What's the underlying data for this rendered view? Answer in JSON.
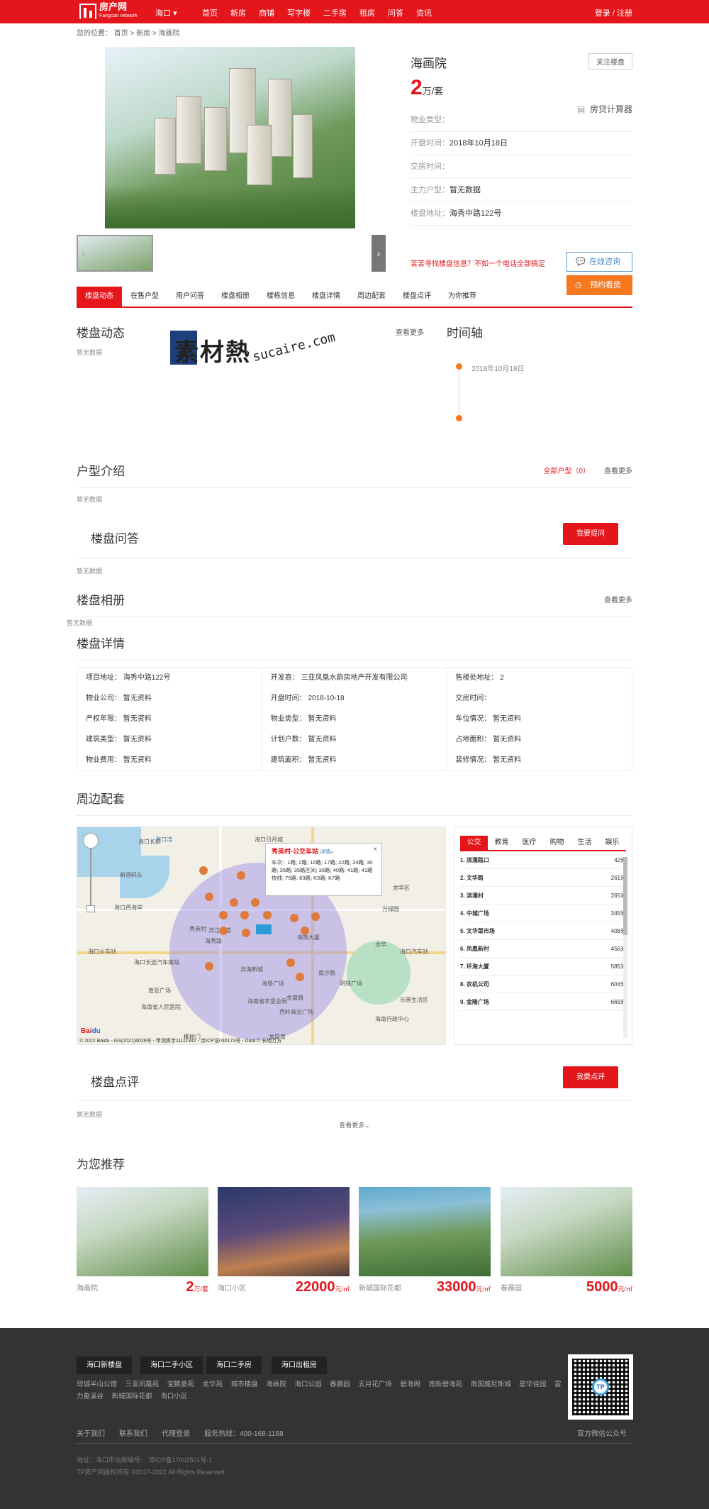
{
  "header": {
    "logo_cn": "房产网",
    "logo_en": "Fangcan network",
    "city": "海口",
    "nav": [
      "首页",
      "新房",
      "商铺",
      "写字楼",
      "二手房",
      "租房",
      "问答",
      "资讯"
    ],
    "login": "登录 / 注册"
  },
  "breadcrumb": "您的位置： 首页 > 新房 > 海画院",
  "property": {
    "name": "海画院",
    "follow": "关注楼盘",
    "price_num": "2",
    "price_unit": "万/套",
    "calc": "房贷计算器",
    "rows": [
      {
        "label": "物业类型：",
        "value": ""
      },
      {
        "label": "开盘时间：",
        "value": "2018年10月18日"
      },
      {
        "label": "交房时间：",
        "value": ""
      },
      {
        "label": "主力户型：",
        "value": "暂无数据"
      },
      {
        "label": "楼盘地址：",
        "value": "海秀中路122号"
      }
    ],
    "hotline": "苦苦寻找楼盘信息？不如一个电话全部搞定",
    "consult": "在线咨询",
    "visit": "预约看房"
  },
  "tabs": [
    "楼盘动态",
    "在售户型",
    "用户问答",
    "楼盘相册",
    "楼栋信息",
    "楼盘详情",
    "周边配套",
    "楼盘点评",
    "为你推荐"
  ],
  "dynamics": {
    "title": "楼盘动态",
    "more": "查看更多",
    "empty": "暂无数据"
  },
  "watermark": {
    "cn": "素材熱",
    "en": "sucaire.com"
  },
  "timeline": {
    "title": "时间轴",
    "date": "2018年10月18日"
  },
  "units": {
    "title": "户型介绍",
    "all": "全部户型（0）",
    "more": "查看更多",
    "empty": "暂无数据"
  },
  "qa": {
    "title": "楼盘问答",
    "button": "我要提问",
    "empty": "暂无数据"
  },
  "album": {
    "title": "楼盘相册",
    "more": "查看更多",
    "empty": "暂无数据"
  },
  "detail": {
    "title": "楼盘详情",
    "rows": [
      [
        "项目地址：  海秀中路122号",
        "开发商：  三亚凤凰水韵房地产开发有限公司",
        "售楼处地址：  2"
      ],
      [
        "物业公司：  暂无资料",
        "开盘时间：  2018-10-18",
        "交房时间："
      ],
      [
        "产权年限：  暂无资料",
        "物业类型：  暂无资料",
        "车位情况：  暂无资料"
      ],
      [
        "建筑类型：  暂无资料",
        "计划户数：  暂无资料",
        "占地面积：  暂无资料"
      ],
      [
        "物业费用：  暂无资料",
        "建筑面积：  暂无资料",
        "装修情况：  暂无资料"
      ]
    ]
  },
  "surround": {
    "title": "周边配套",
    "popup_title": "秀英村-公交车站",
    "popup_link": "详情»",
    "popup_body": "车次：1路; 2路; 16路; 17路; 22路; 24路; 30路; 35路; 35路区间; 36路; 40路; 41路; 41路快线; 75路; 83路; K5路; K7路",
    "map_labels": [
      "海口长影",
      "海口西海岸",
      "秀英村",
      "海秀路",
      "滨江大道",
      "海口火车站",
      "海口长途汽车南站",
      "海南省人民医院",
      "万绿园",
      "南沙路",
      "龙华",
      "海南大厦",
      "海垦广场",
      "海南省农垦总局",
      "西岭商业广场",
      "明珠广场",
      "滨海新城",
      "海口汽车站",
      "海南行政中心",
      "乐普生活区",
      "椰树门",
      "海口日月城",
      "南亚广场",
      "龙昆南",
      "龙华区",
      "金盘路",
      "海口湾",
      "新港码头"
    ],
    "map_footer": "© 2022 Baidu - GS(2021)6026号 - 甲测资字11111342 - 京ICP证030173号 - Data © 长地万方",
    "poi_tabs": [
      "公交",
      "教育",
      "医疗",
      "购物",
      "生活",
      "娱乐"
    ],
    "poi": [
      [
        "1. 滨濡路口",
        "42米"
      ],
      [
        "2. 文华路",
        "261米"
      ],
      [
        "3. 滨濡村",
        "265米"
      ],
      [
        "4. 中城广场",
        "345米"
      ],
      [
        "5. 文华菜市场",
        "408米"
      ],
      [
        "6. 凤凰新村",
        "456米"
      ],
      [
        "7. 环海大厦",
        "585米"
      ],
      [
        "8. 农机公司",
        "604米"
      ],
      [
        "9. 金隆广场",
        "669米"
      ]
    ]
  },
  "review": {
    "title": "楼盘点评",
    "button": "我要点评",
    "empty": "暂无数据",
    "more": "查看更多"
  },
  "recommend": {
    "title": "为您推荐",
    "items": [
      {
        "name": "海画院",
        "price": "2",
        "unit": "万/套"
      },
      {
        "name": "海口小区",
        "price": "22000",
        "unit": "元/㎡"
      },
      {
        "name": "新城国际花都",
        "price": "33000",
        "unit": "元/㎡"
      },
      {
        "name": "春晨园",
        "price": "5000",
        "unit": "元/㎡"
      }
    ]
  },
  "footer": {
    "tabs": [
      "海口新楼盘",
      "海口二手小区",
      "海口二手房",
      "海口出租房"
    ],
    "links": [
      "琼城半山公馆",
      "三亚凤凰苑",
      "宝鹏豪苑",
      "龙华苑",
      "城市楼盘",
      "海画院",
      "海口公园",
      "春晨园",
      "五月花广场",
      "碧海阁",
      "南新碧海苑",
      "南国威尼斯城",
      "星华佳园",
      "富力盈溪谷",
      "新城国际花都",
      "海口小区"
    ],
    "nav": [
      "关于我们",
      "联系我们",
      "代理登录",
      "服务热线：400-168-1168"
    ],
    "qr_label": "官方微信公众号",
    "qr_text": "TP",
    "addr": "地址：海口市站邮编号：  琼ICP备17002501号-1",
    "copy": "TP房产网版权所有 ©2017-2022 All Rights Reserved"
  }
}
